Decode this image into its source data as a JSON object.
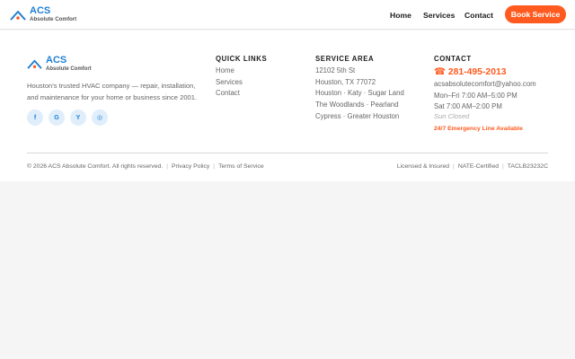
{
  "brand": {
    "name": "ACS",
    "tagline": "Absolute Comfort",
    "primary_color": "#1f7fd1",
    "accent_color": "#ff5a1f",
    "logo_icon": "house-roof-icon"
  },
  "nav": {
    "items": [
      "Home",
      "Services",
      "Contact"
    ],
    "cta": "Book Service"
  },
  "footer": {
    "about": "Houston's trusted HVAC company — repair, installation, and maintenance for your home or business since 2001.",
    "socials": [
      {
        "icon": "facebook-icon",
        "glyph": "f"
      },
      {
        "icon": "google-icon",
        "glyph": "G"
      },
      {
        "icon": "yelp-icon",
        "glyph": "Y"
      },
      {
        "icon": "instagram-icon",
        "glyph": "◎"
      }
    ],
    "quick_links": {
      "title": "QUICK LINKS",
      "items": [
        "Home",
        "Services",
        "Contact"
      ]
    },
    "service_area": {
      "title": "SERVICE AREA",
      "items": [
        "12102 5th St",
        "Houston, TX 77072",
        "Houston · Katy · Sugar Land",
        "The Woodlands · Pearland",
        "Cypress · Greater Houston"
      ]
    },
    "contact": {
      "title": "CONTACT",
      "phone": "☎ 281-495-2013",
      "email": "acsabsolutecomfort@yahoo.com",
      "hours_weekday": "Mon–Fri 7:00 AM–5:00 PM",
      "hours_sat": "Sat 7:00 AM–2:00 PM",
      "hours_sun": "Sun Closed",
      "emergency": "24/7 Emergency Line Available"
    },
    "bottom": {
      "copyright": "© 2026 ACS Absolute Comfort. All rights reserved.",
      "privacy": "Privacy Policy",
      "terms": "Terms of Service",
      "licensed": "Licensed & Insured",
      "certified": "NATE-Certified",
      "license_no": "TACLB23232C",
      "separator": "|"
    }
  }
}
